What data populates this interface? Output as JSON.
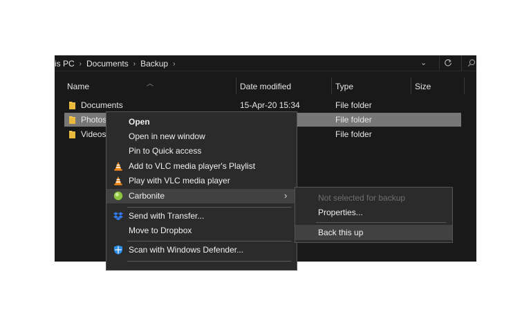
{
  "breadcrumb": {
    "items": [
      "is PC",
      "Documents",
      "Backup"
    ],
    "separator": "›"
  },
  "columns": {
    "name": "Name",
    "date_modified": "Date modified",
    "type": "Type",
    "size": "Size"
  },
  "files": [
    {
      "name": "Documents",
      "date": "15-Apr-20 15:34",
      "type": "File folder",
      "selected": false
    },
    {
      "name": "Photos",
      "date": "",
      "type": "File folder",
      "selected": true
    },
    {
      "name": "Videos",
      "date": "",
      "type": "File folder",
      "selected": false
    }
  ],
  "context_menu": {
    "open": "Open",
    "open_new_window": "Open in new window",
    "pin_quick_access": "Pin to Quick access",
    "add_vlc_playlist": "Add to VLC media player's Playlist",
    "play_vlc": "Play with VLC media player",
    "carbonite": "Carbonite",
    "send_transfer": "Send with Transfer...",
    "move_dropbox": "Move to Dropbox",
    "scan_defender": "Scan with Windows Defender..."
  },
  "carbonite_submenu": {
    "not_selected": "Not selected for backup",
    "properties": "Properties...",
    "back_this_up": "Back this up"
  },
  "icons": {
    "folder": "folder-icon",
    "vlc": "vlc-cone-icon",
    "carbonite": "carbonite-globe-icon",
    "dropbox": "dropbox-icon",
    "defender": "windows-defender-shield-icon"
  },
  "colors": {
    "window_bg": "#191919",
    "menu_bg": "#2b2b2b",
    "selection": "#777777",
    "folder": "#f0c84b",
    "vlc_orange": "#f28a1a",
    "carbonite_green": "#8cc63f",
    "dropbox_blue": "#2f7cf6",
    "defender_blue": "#2f8fe6"
  }
}
